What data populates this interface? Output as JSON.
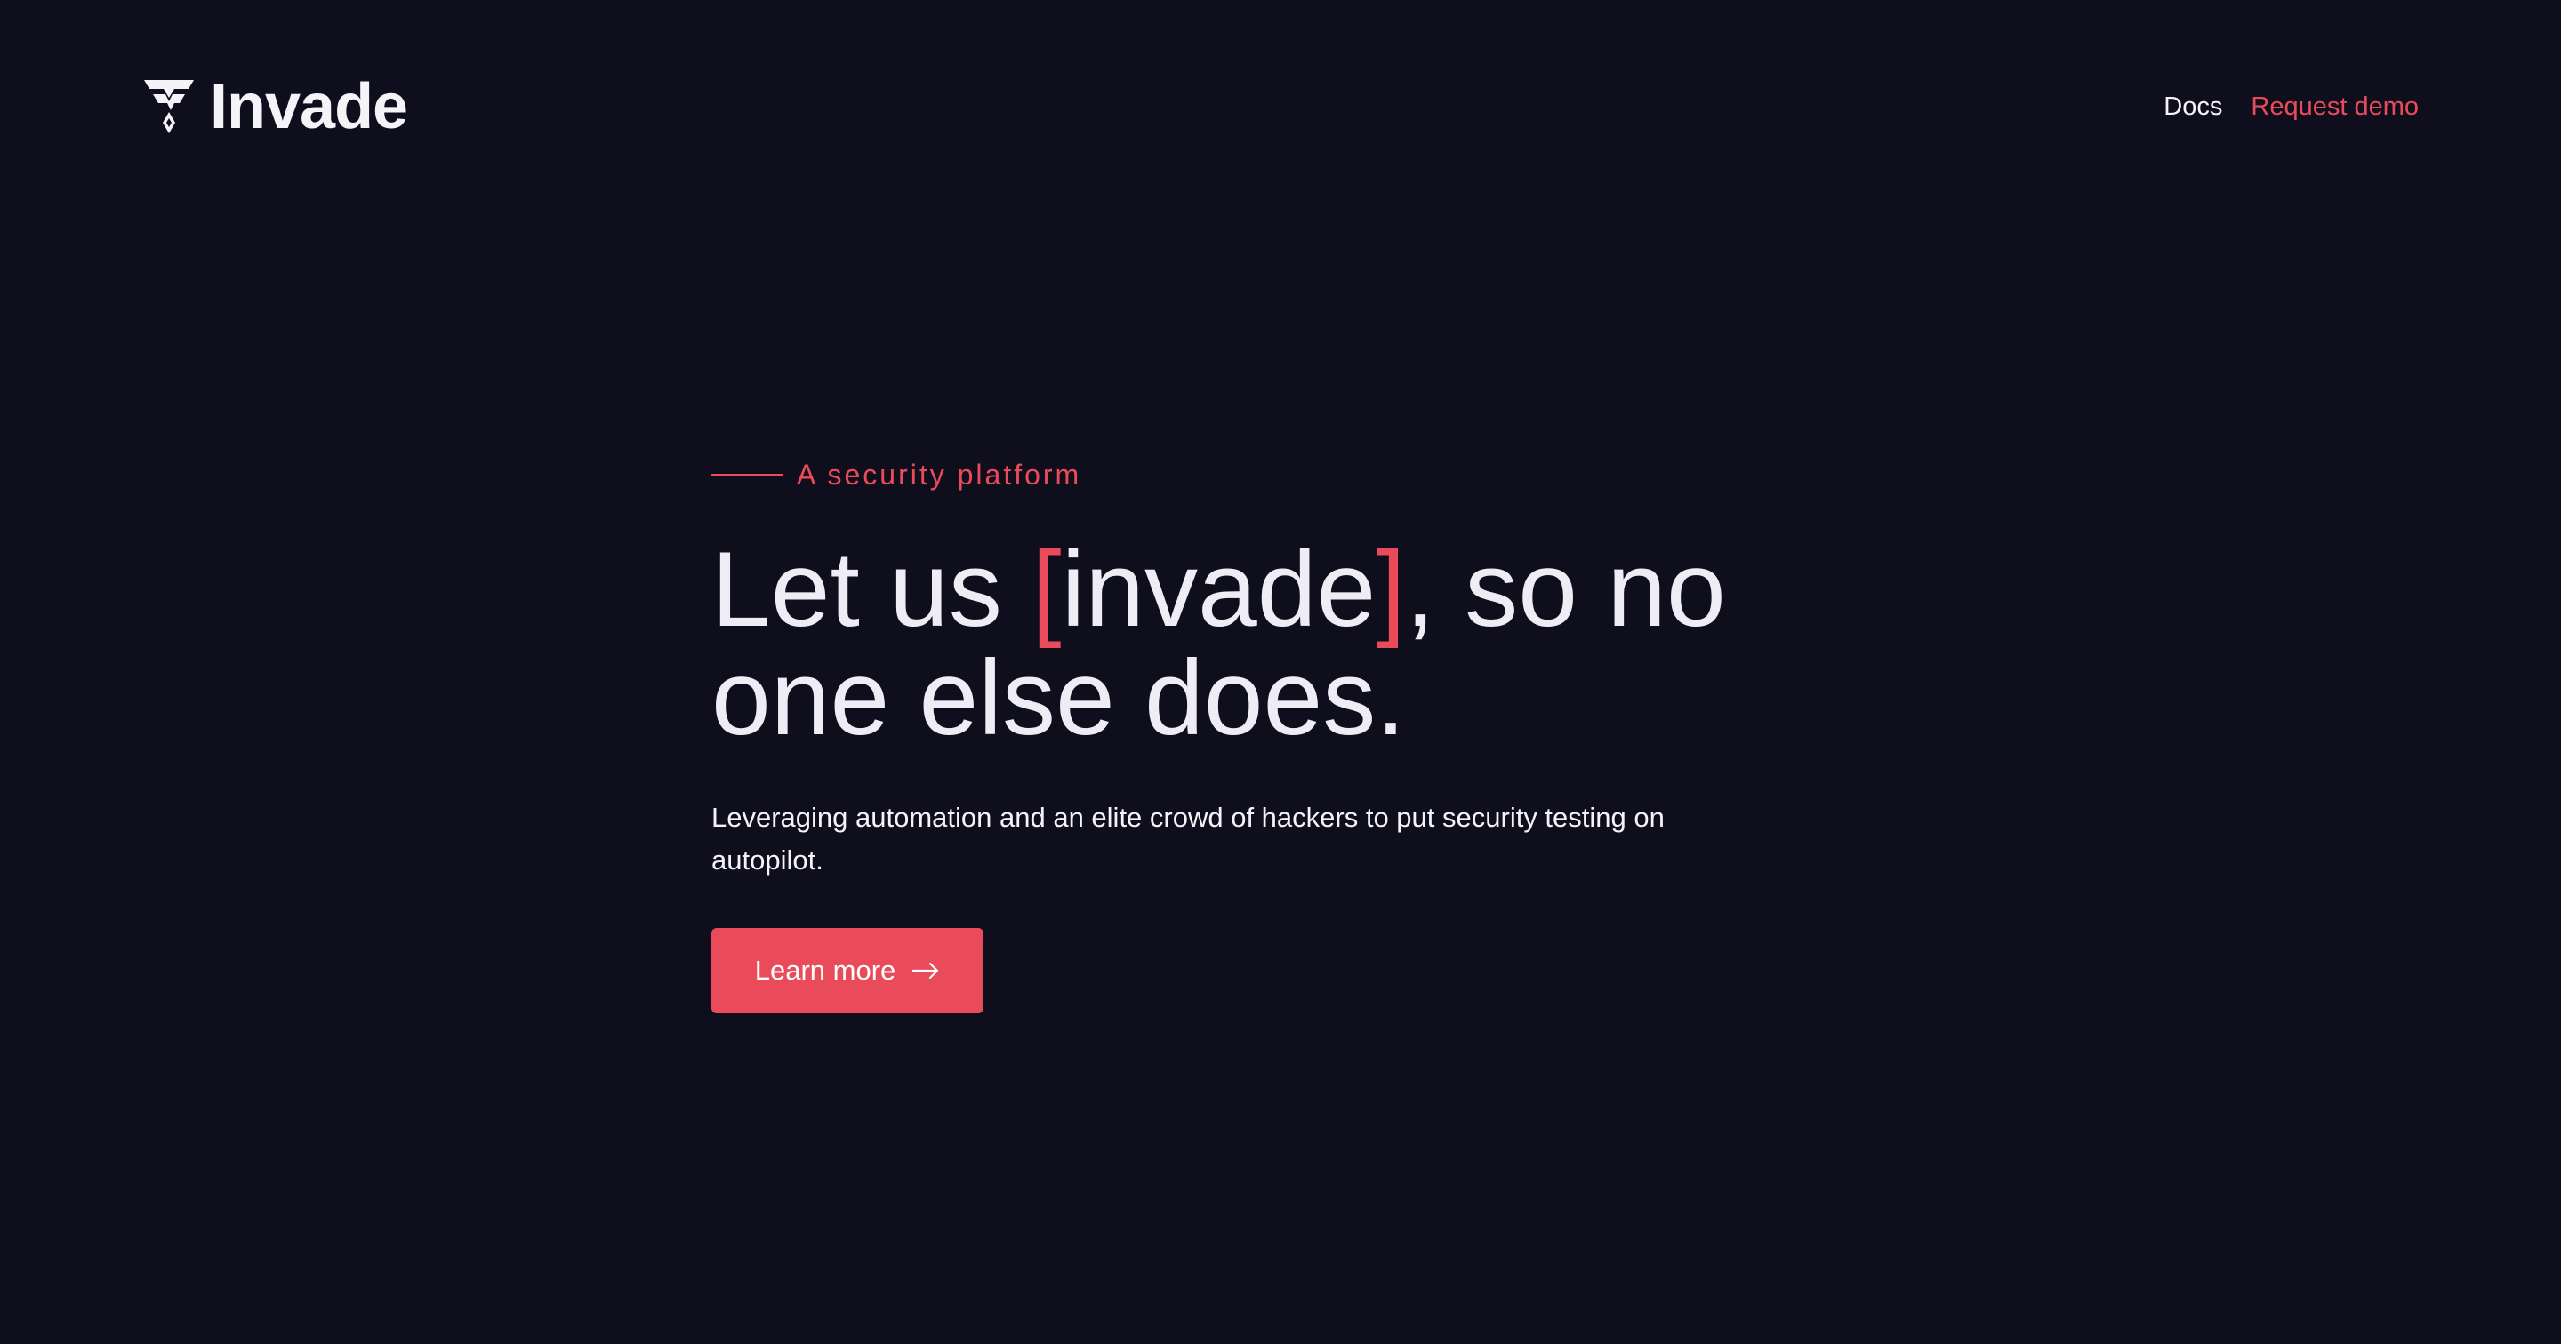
{
  "brand": {
    "name": "Invade"
  },
  "nav": {
    "docs_label": "Docs",
    "demo_label": "Request demo"
  },
  "hero": {
    "eyebrow": "A security platform",
    "headline": {
      "pre": "Let us ",
      "open_bracket": "[",
      "highlight": "invade",
      "close_bracket": "]",
      "post": ", so no one else does."
    },
    "subtext": "Leveraging automation and an elite crowd of hackers to put security testing on autopilot.",
    "cta_label": "Learn more",
    "cta_icon": "arrow-right-icon"
  },
  "colors": {
    "background": "#0f0e1d",
    "accent": "#ea4b5a",
    "text": "#eeedf5"
  }
}
